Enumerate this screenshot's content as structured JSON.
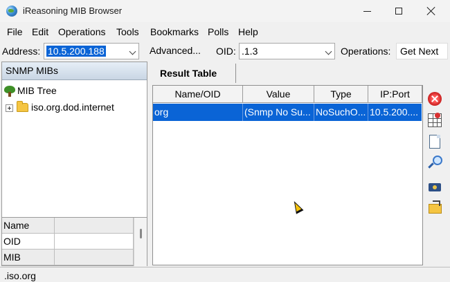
{
  "window": {
    "title": "iReasoning MIB Browser"
  },
  "menu": [
    "File",
    "Edit",
    "Operations",
    "Tools",
    "Bookmarks",
    "Polls",
    "Help"
  ],
  "toolbar": {
    "address_label": "Address:",
    "address_value": "10.5.200.188",
    "advanced_label": "Advanced...",
    "oid_label": "OID:",
    "oid_value": ".1.3",
    "operations_label": "Operations:",
    "operations_value": "Get Next"
  },
  "left": {
    "header": "SNMP MIBs",
    "tree": {
      "root": "MIB Tree",
      "child": "iso.org.dod.internet"
    },
    "props": {
      "rows": [
        "Name",
        "OID",
        "MIB"
      ]
    }
  },
  "result": {
    "tab": "Result Table",
    "columns": [
      "Name/OID",
      "Value",
      "Type",
      "IP:Port"
    ],
    "rows": [
      {
        "name": "org",
        "value": "(Snmp No Su...",
        "type": "NoSuchO...",
        "ipport": "10.5.200...."
      }
    ]
  },
  "status": {
    "text": ".iso.org"
  },
  "icons": {
    "app": "globe-icon",
    "tools": [
      "delete-icon",
      "clear-table-icon",
      "document-icon",
      "find-icon",
      "capture-icon",
      "open-folder-icon"
    ]
  }
}
